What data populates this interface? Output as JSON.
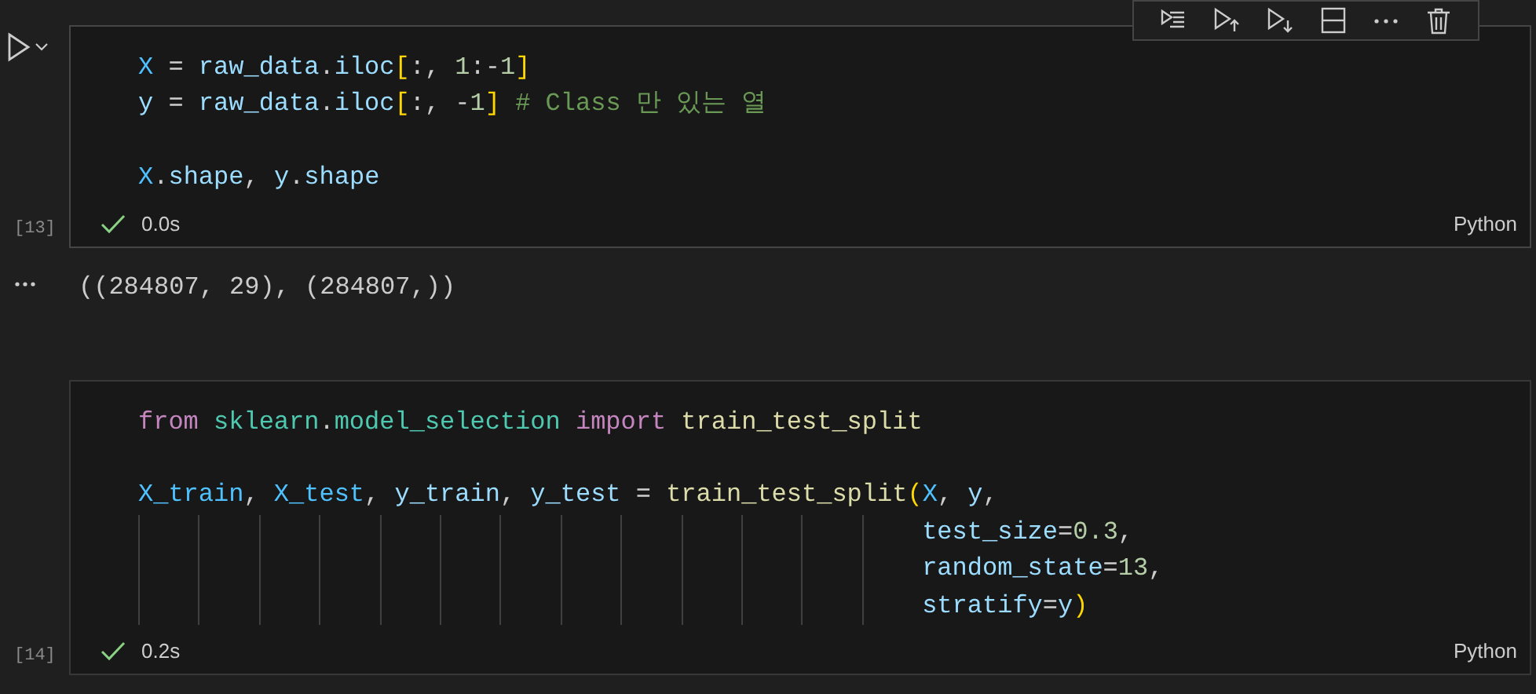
{
  "cells": [
    {
      "focused": true,
      "execution_count": "[13]",
      "succeeded": true,
      "duration": "0.0s",
      "language": "Python",
      "lines": [
        {
          "kind": "code",
          "tokens": [
            {
              "kind": "constant",
              "text": "X"
            },
            {
              "kind": "plain",
              "text": " = "
            },
            {
              "kind": "variable",
              "text": "raw_data"
            },
            {
              "kind": "plain",
              "text": "."
            },
            {
              "kind": "variable",
              "text": "iloc"
            },
            {
              "kind": "bracket",
              "text": "["
            },
            {
              "kind": "plain",
              "text": ":, "
            },
            {
              "kind": "number",
              "text": "1"
            },
            {
              "kind": "plain",
              "text": ":-"
            },
            {
              "kind": "number",
              "text": "1"
            },
            {
              "kind": "bracket",
              "text": "]"
            }
          ]
        },
        {
          "kind": "code",
          "tokens": [
            {
              "kind": "variable",
              "text": "y"
            },
            {
              "kind": "plain",
              "text": " = "
            },
            {
              "kind": "variable",
              "text": "raw_data"
            },
            {
              "kind": "plain",
              "text": "."
            },
            {
              "kind": "variable",
              "text": "iloc"
            },
            {
              "kind": "bracket",
              "text": "["
            },
            {
              "kind": "plain",
              "text": ":, -"
            },
            {
              "kind": "number",
              "text": "1"
            },
            {
              "kind": "bracket",
              "text": "]"
            },
            {
              "kind": "comment",
              "text": " # Class 만 있는 열"
            }
          ]
        },
        {
          "kind": "blank"
        },
        {
          "kind": "code",
          "tokens": [
            {
              "kind": "constant",
              "text": "X"
            },
            {
              "kind": "plain",
              "text": "."
            },
            {
              "kind": "variable",
              "text": "shape"
            },
            {
              "kind": "plain",
              "text": ", "
            },
            {
              "kind": "variable",
              "text": "y"
            },
            {
              "kind": "plain",
              "text": "."
            },
            {
              "kind": "variable",
              "text": "shape"
            }
          ]
        }
      ],
      "output": "((284807, 29), (284807,))"
    },
    {
      "focused": false,
      "execution_count": "[14]",
      "succeeded": true,
      "duration": "0.2s",
      "language": "Python",
      "lines": [
        {
          "kind": "code",
          "tokens": [
            {
              "kind": "keyword",
              "text": "from"
            },
            {
              "kind": "module",
              "text": " sklearn"
            },
            {
              "kind": "plain",
              "text": "."
            },
            {
              "kind": "module",
              "text": "model_selection"
            },
            {
              "kind": "keyword",
              "text": " import"
            },
            {
              "kind": "function",
              "text": " train_test_split"
            }
          ]
        },
        {
          "kind": "blank"
        },
        {
          "kind": "code",
          "tokens": [
            {
              "kind": "constant",
              "text": "X_train"
            },
            {
              "kind": "plain",
              "text": ", "
            },
            {
              "kind": "constant",
              "text": "X_test"
            },
            {
              "kind": "plain",
              "text": ", "
            },
            {
              "kind": "variable",
              "text": "y_train"
            },
            {
              "kind": "plain",
              "text": ", "
            },
            {
              "kind": "variable",
              "text": "y_test"
            },
            {
              "kind": "plain",
              "text": " = "
            },
            {
              "kind": "function",
              "text": "train_test_split"
            },
            {
              "kind": "bracket",
              "text": "("
            },
            {
              "kind": "constant",
              "text": "X"
            },
            {
              "kind": "plain",
              "text": ", "
            },
            {
              "kind": "variable",
              "text": "y"
            },
            {
              "kind": "plain",
              "text": ","
            }
          ]
        },
        {
          "kind": "code",
          "tokens": [
            {
              "kind": "variable",
              "text": "                                                    test_size"
            },
            {
              "kind": "plain",
              "text": "="
            },
            {
              "kind": "number",
              "text": "0.3"
            },
            {
              "kind": "plain",
              "text": ","
            }
          ]
        },
        {
          "kind": "code",
          "tokens": [
            {
              "kind": "variable",
              "text": "                                                    random_state"
            },
            {
              "kind": "plain",
              "text": "="
            },
            {
              "kind": "number",
              "text": "13"
            },
            {
              "kind": "plain",
              "text": ","
            }
          ]
        },
        {
          "kind": "code",
          "tokens": [
            {
              "kind": "variable",
              "text": "                                                    stratify"
            },
            {
              "kind": "plain",
              "text": "="
            },
            {
              "kind": "variable",
              "text": "y"
            },
            {
              "kind": "bracket",
              "text": ")"
            }
          ]
        }
      ]
    }
  ]
}
